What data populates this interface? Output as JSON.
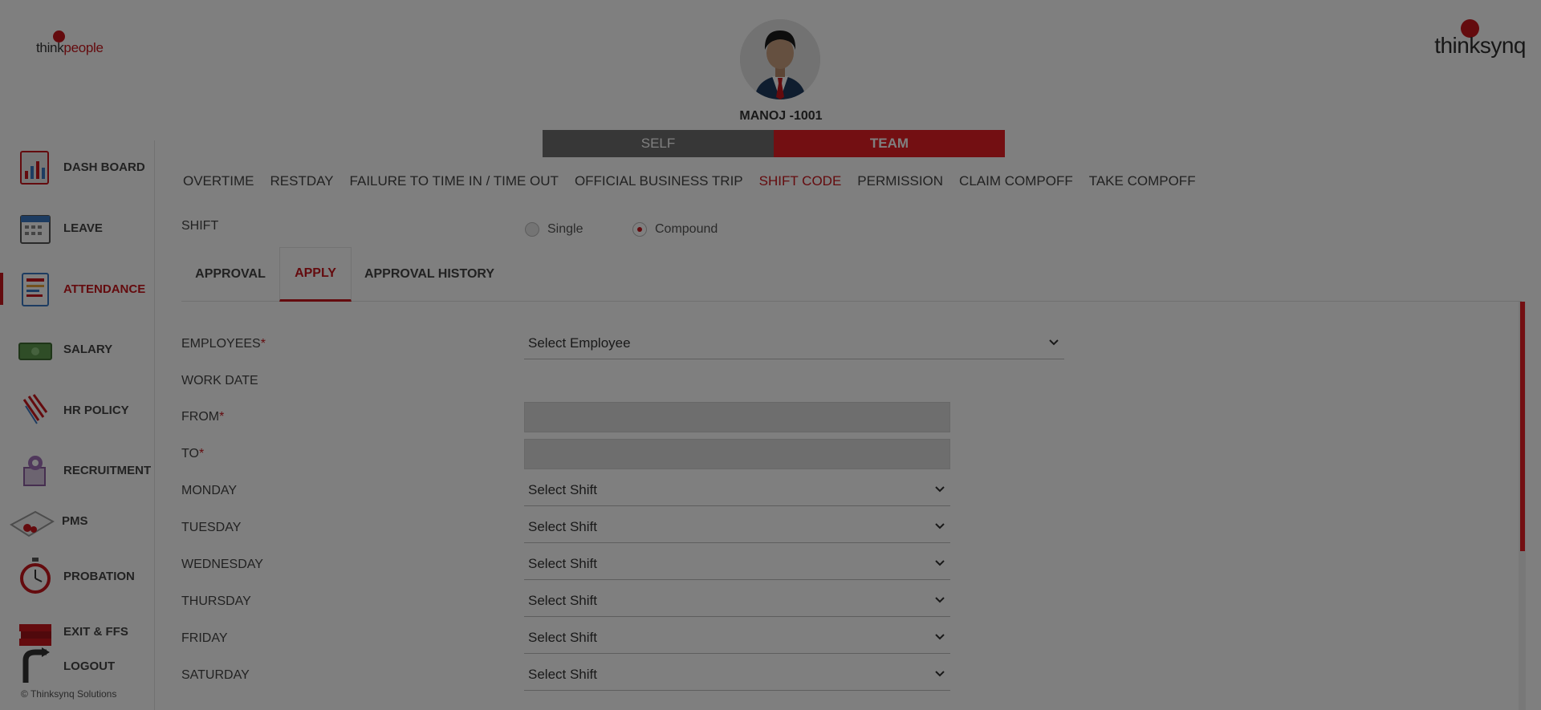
{
  "header": {
    "logo_left": {
      "think": "think",
      "people": "people"
    },
    "logo_right": "thinksynq",
    "user_name": "MANOJ -1001",
    "toggle": {
      "self": "SELF",
      "team": "TEAM",
      "active": "team"
    }
  },
  "sidebar": {
    "items": [
      {
        "label": "DASH BOARD",
        "icon": "dashboard-icon"
      },
      {
        "label": "LEAVE",
        "icon": "calendar-icon"
      },
      {
        "label": "ATTENDANCE",
        "icon": "attendance-icon",
        "active": true
      },
      {
        "label": "SALARY",
        "icon": "money-icon"
      },
      {
        "label": "HR POLICY",
        "icon": "policy-icon"
      },
      {
        "label": "RECRUITMENT",
        "icon": "recruitment-icon"
      },
      {
        "label": "PMS",
        "icon": "pms-icon"
      },
      {
        "label": "PROBATION",
        "icon": "stopwatch-icon"
      },
      {
        "label": "EXIT & FFS",
        "icon": "books-icon"
      },
      {
        "label": "LOGOUT",
        "icon": "logout-icon"
      }
    ],
    "copyright": "© Thinksynq Solutions"
  },
  "top_tabs": [
    {
      "label": "OVERTIME"
    },
    {
      "label": "RESTDAY"
    },
    {
      "label": "FAILURE TO TIME IN / TIME OUT"
    },
    {
      "label": "OFFICIAL BUSINESS TRIP"
    },
    {
      "label": "SHIFT CODE",
      "active": true
    },
    {
      "label": "PERMISSION"
    },
    {
      "label": "CLAIM COMPOFF"
    },
    {
      "label": "TAKE COMPOFF"
    }
  ],
  "shift": {
    "label": "SHIFT",
    "options": [
      "Single",
      "Compound"
    ],
    "selected": "Compound"
  },
  "sub_tabs": [
    {
      "label": "APPROVAL"
    },
    {
      "label": "APPLY",
      "active": true
    },
    {
      "label": "APPROVAL HISTORY"
    }
  ],
  "form": {
    "employees": {
      "label": "EMPLOYEES",
      "required": "*",
      "value": "Select Employee"
    },
    "work_date": {
      "label": "WORK DATE"
    },
    "from": {
      "label": "FROM",
      "required": "*",
      "value": ""
    },
    "to": {
      "label": "TO",
      "required": "*",
      "value": ""
    },
    "days": [
      {
        "label": "MONDAY",
        "value": "Select Shift"
      },
      {
        "label": "TUESDAY",
        "value": "Select Shift"
      },
      {
        "label": "WEDNESDAY",
        "value": "Select Shift"
      },
      {
        "label": "THURSDAY",
        "value": "Select Shift"
      },
      {
        "label": "FRIDAY",
        "value": "Select Shift"
      },
      {
        "label": "SATURDAY",
        "value": "Select Shift"
      }
    ]
  },
  "colors": {
    "accent": "#c8161d",
    "team_bg": "#e61e25",
    "self_bg": "#6e6e6e",
    "overlay": "rgba(0,0,0,0.5)"
  }
}
